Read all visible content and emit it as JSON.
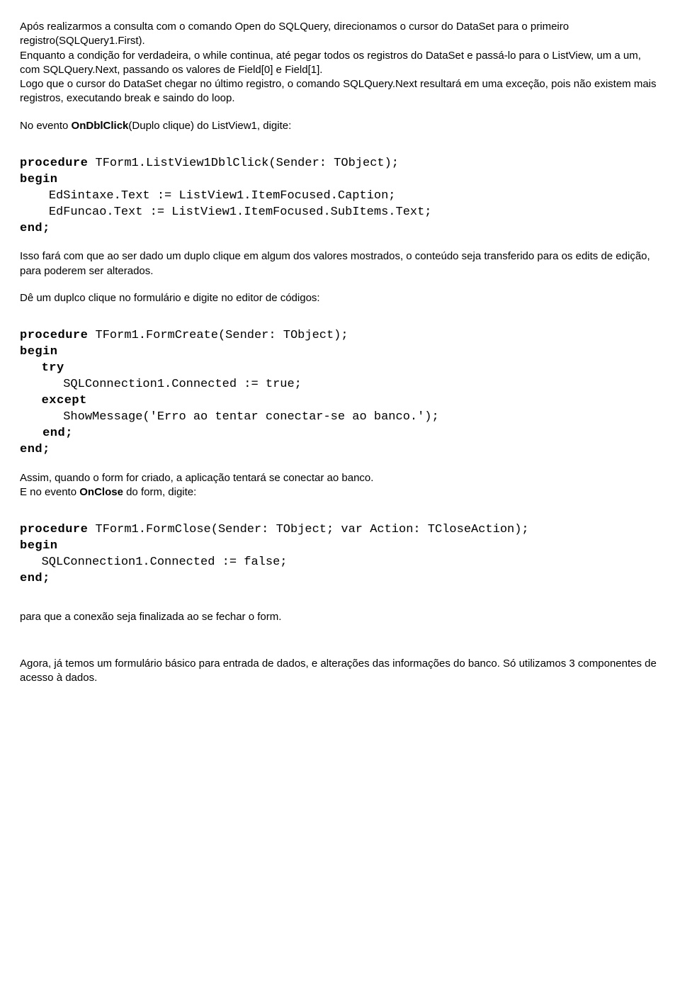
{
  "para1": "Após realizarmos a consulta com o comando Open do SQLQuery, direcionamos o cursor do DataSet para o primeiro registro(SQLQuery1.First).",
  "para2": "Enquanto a condição for verdadeira, o while continua, até pegar todos os registros do DataSet e passá-lo para o ListView, um a um, com SQLQuery.Next, passando os valores de Field[0] e Field[1].",
  "para3": "Logo que o cursor do DataSet chegar no último registro, o comando SQLQuery.Next resultará em uma exceção, pois não existem mais registros, executando break e saindo do loop.",
  "para4_prefix": "No evento ",
  "para4_bold": "OnDblClick",
  "para4_suffix": "(Duplo clique) do ListView1, digite:",
  "code1_sig": " TForm1.ListView1DblClick(Sender: TObject);",
  "code1_l1": "    EdSintaxe.Text := ListView1.ItemFocused.Caption;",
  "code1_l2": "    EdFuncao.Text := ListView1.ItemFocused.SubItems.Text;",
  "para5": "Isso fará com que ao ser dado um duplo clique em algum dos valores mostrados, o conteúdo seja transferido para os edits de edição, para poderem ser alterados.",
  "para6": "Dê um duplco clique no formulário e digite no editor de códigos:",
  "code2_sig": " TForm1.FormCreate(Sender: TObject);",
  "code2_l1": "      SQLConnection1.Connected := true;",
  "code2_l2": "      ShowMessage('Erro ao tentar conectar-se ao banco.');",
  "para7_l1": "Assim, quando o form for criado, a aplicação tentará se conectar ao banco.",
  "para7_l2a": "E no evento ",
  "para7_l2b": "OnClose",
  "para7_l2c": " do form, digite:",
  "code3_sig": " TForm1.FormClose(Sender: TObject; var Action: TCloseAction);",
  "code3_l1": "   SQLConnection1.Connected := false;",
  "para8": "para que a conexão seja finalizada ao se fechar o form.",
  "para9": "Agora, já temos um formulário básico para entrada de dados, e alterações das informações do banco. Só utilizamos 3 componentes de acesso à dados.",
  "kw_procedure": "procedure",
  "kw_begin": "begin",
  "kw_end": "end;",
  "kw_try": "try",
  "kw_except": "except",
  "kw_end_inner": "   end;"
}
